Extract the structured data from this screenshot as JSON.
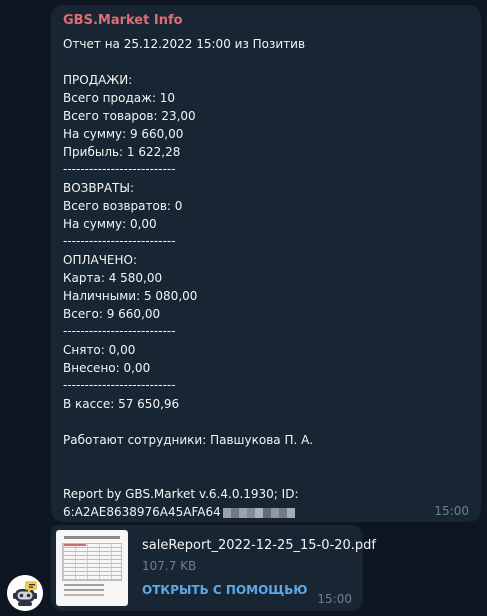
{
  "message": {
    "sender": "GBS.Market Info",
    "lines": [
      "Отчет на 25.12.2022 15:00 из Позитив",
      "",
      "ПРОДАЖИ:",
      "Всего продаж: 10",
      "Всего товаров: 23,00",
      "На сумму: 9 660,00",
      "Прибыль: 1 622,28",
      "--------------------------",
      "ВОЗВРАТЫ:",
      "Всего возвратов: 0",
      "На сумму: 0,00",
      "--------------------------",
      "ОПЛАЧЕНО:",
      "Карта: 4 580,00",
      "Наличными: 5 080,00",
      "Всего: 9 660,00",
      "--------------------------",
      "Снято: 0,00",
      "Внесено: 0,00",
      "--------------------------",
      "В кассе: 57 650,96",
      "",
      "Работают сотрудники: Павшукова П. А.",
      "",
      "",
      "Report by GBS.Market v.6.4.0.1930; ID:",
      "6:A2AE8638976A45AFA64"
    ],
    "time": "15:00"
  },
  "file_message": {
    "file_name": "saleReport_2022-12-25_15-0-20.pdf",
    "file_size": "107.7 KB",
    "action_label": "ОТКРЫТЬ С ПОМОЩЬЮ",
    "time": "15:00"
  },
  "icons": {
    "avatar": "bot-avatar-icon",
    "thumbnail": "pdf-thumbnail"
  },
  "colors": {
    "background": "#0e1621",
    "bubble": "#182533",
    "sender": "#e06c75",
    "link": "#5fa8e8",
    "time": "#6d7f8f"
  }
}
